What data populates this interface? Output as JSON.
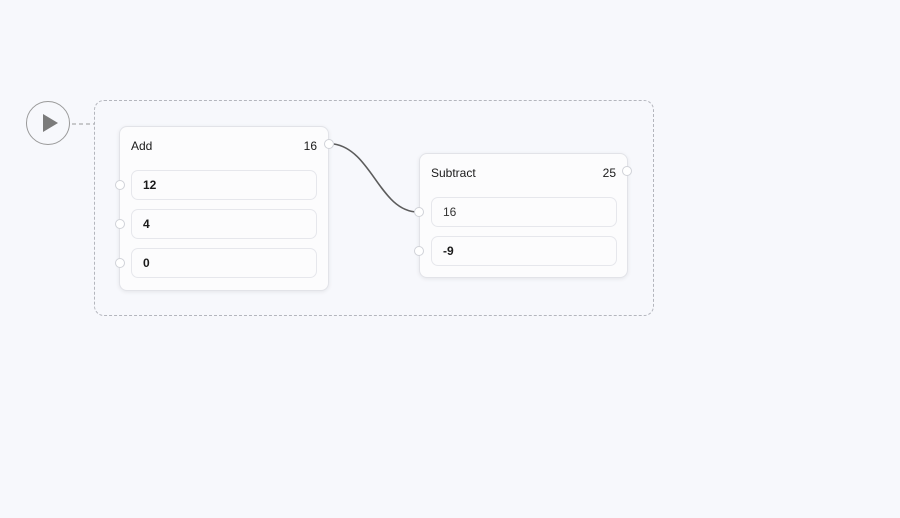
{
  "nodes": {
    "add": {
      "title": "Add",
      "result": "16",
      "inputs": [
        "12",
        "4",
        "0"
      ]
    },
    "subtract": {
      "title": "Subtract",
      "result": "25",
      "inputs": [
        "16",
        "-9"
      ]
    }
  },
  "colors": {
    "background": "#f7f8fc",
    "wire": "#5c5c5c",
    "group_border": "#b4b6bd"
  },
  "icons": {
    "run": "play-icon"
  }
}
